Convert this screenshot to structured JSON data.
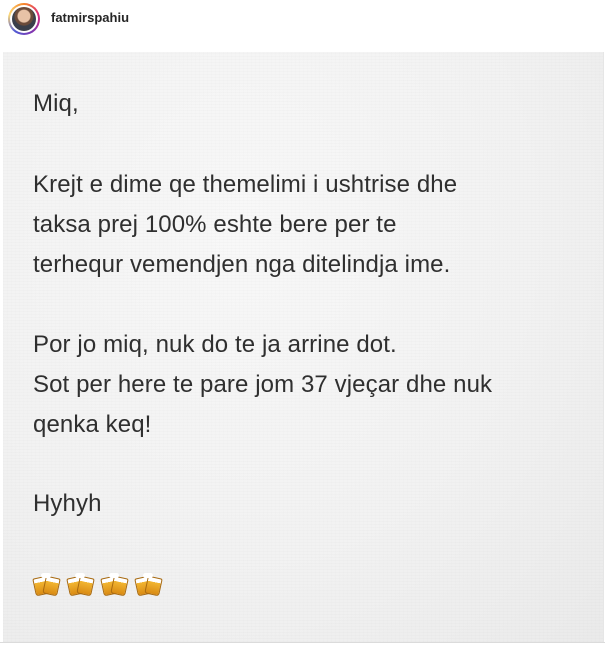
{
  "header": {
    "username": "fatmirspahiu",
    "avatar_icon": "profile-avatar-icon"
  },
  "post": {
    "lines": [
      "Miq,",
      "Krejt e dime qe themelimi i ushtrise dhe",
      "taksa prej 100% eshte bere per te",
      "terhequr vemendjen nga ditelindja ime.",
      "Por jo miq, nuk do te ja arrine dot.",
      "Sot per here te pare jom 37 vjeçar dhe nuk",
      "qenka keq!",
      "Hyhyh"
    ],
    "emoji": [
      "beer-mugs-icon",
      "beer-mugs-icon",
      "beer-mugs-icon",
      "beer-mugs-icon"
    ]
  }
}
